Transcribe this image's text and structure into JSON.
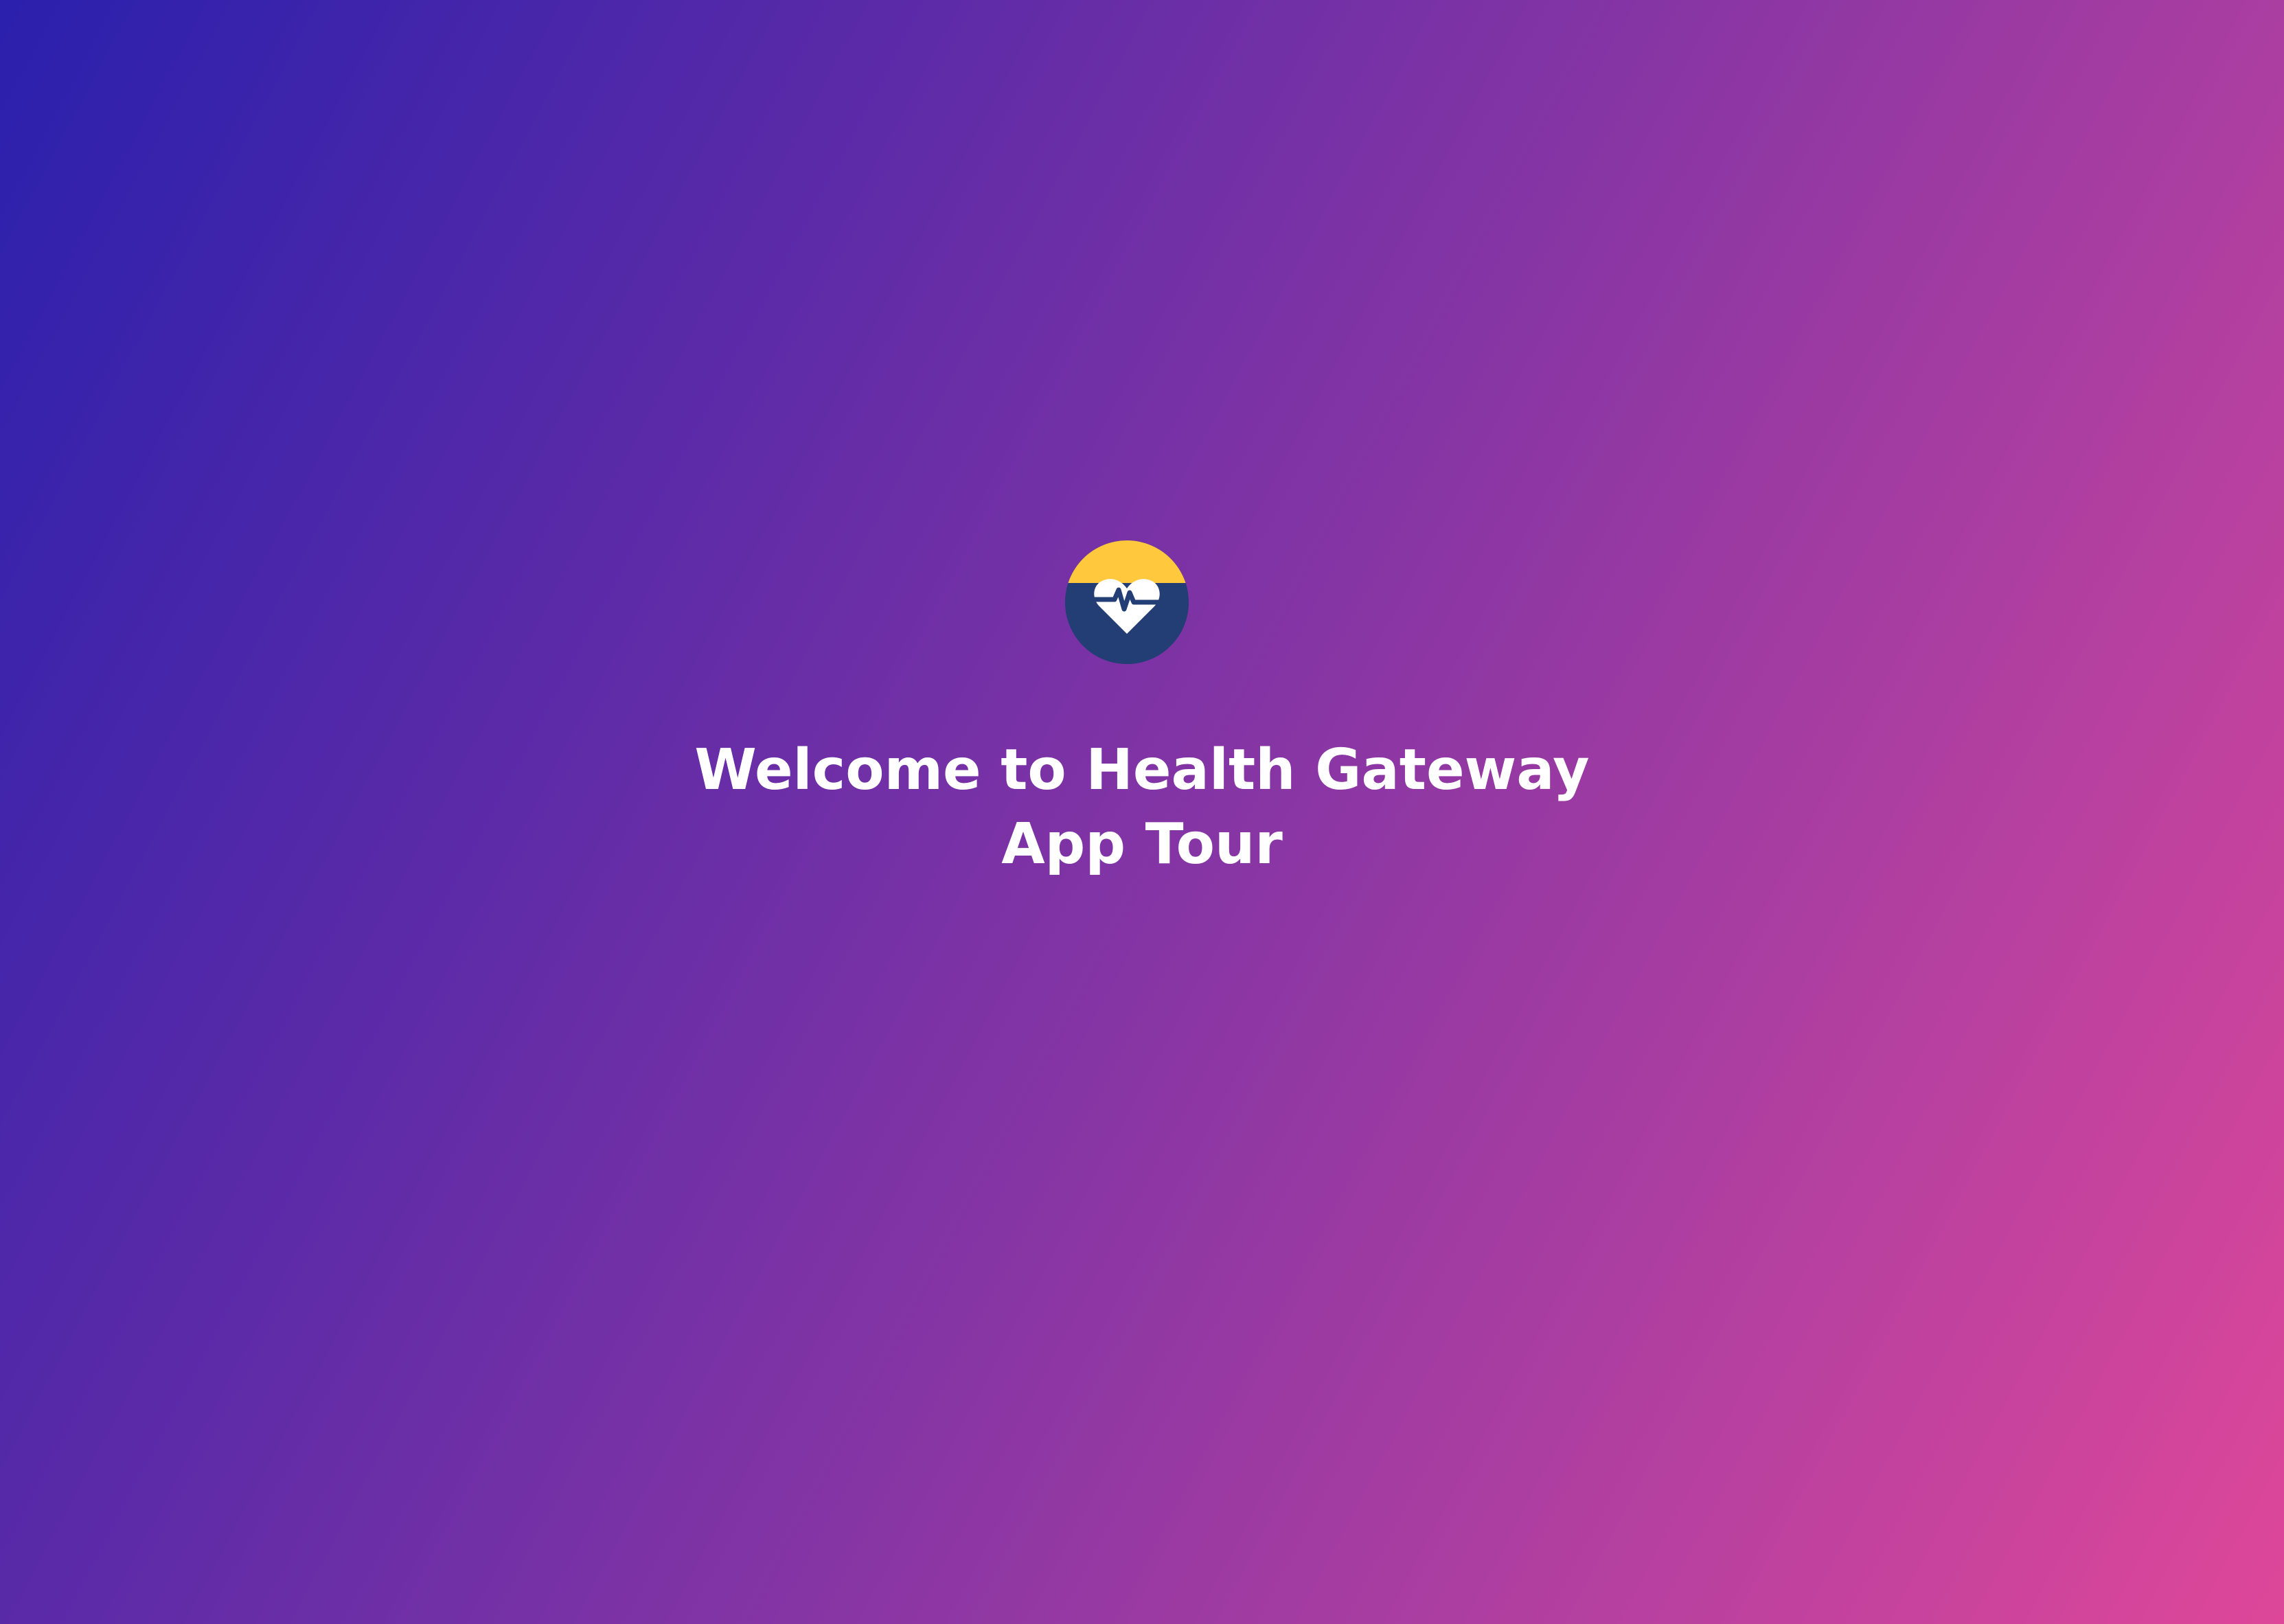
{
  "welcome": {
    "title_line1": "Welcome to Health Gateway",
    "title_line2": "App Tour"
  },
  "logo": {
    "icon": "heart-pulse-icon",
    "top_color": "#ffc83d",
    "bottom_color": "#223e74",
    "heart_color": "#ffffff"
  },
  "colors": {
    "gradient_start": "#2a20ad",
    "gradient_end": "#de4799",
    "text": "#ffffff"
  }
}
